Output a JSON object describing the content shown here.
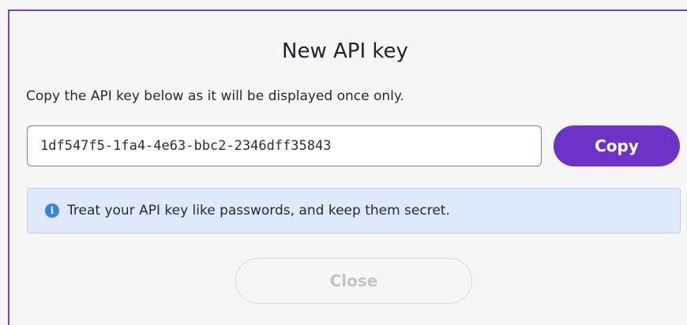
{
  "dialog": {
    "title": "New API key",
    "description": "Copy the API key below as it will be displayed once only.",
    "api_key": "1df547f5-1fa4-4e63-bbc2-2346dff35843",
    "copy_label": "Copy",
    "notice": {
      "icon": "info-icon",
      "icon_glyph": "i",
      "text": "Treat your API key like passwords, and keep them secret."
    },
    "close_label": "Close"
  },
  "colors": {
    "accent": "#6d33c7",
    "info": "#3b82e6",
    "notice_bg": "#dfe9fb"
  }
}
